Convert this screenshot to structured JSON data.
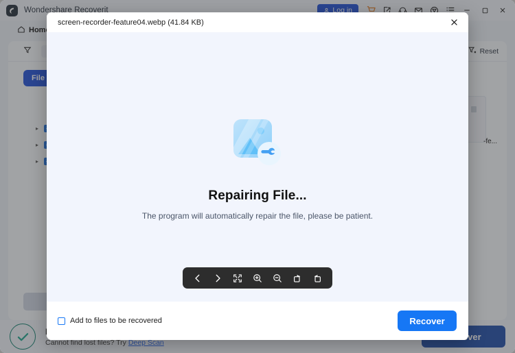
{
  "app": {
    "title": "Wondershare Recoverit",
    "logo_icon": "recoverit-logo-icon",
    "login_label": "Log in",
    "titlebar_icons": [
      {
        "name": "cart-icon"
      },
      {
        "name": "export-icon"
      },
      {
        "name": "headset-icon"
      },
      {
        "name": "mail-icon"
      },
      {
        "name": "history-icon"
      },
      {
        "name": "menu-list-icon"
      }
    ],
    "window_controls": [
      {
        "name": "minimize-button",
        "glyph": "–"
      },
      {
        "name": "maximize-button",
        "glyph": "☐"
      },
      {
        "name": "close-button",
        "glyph": "✕"
      }
    ]
  },
  "nav": {
    "home_label": "Home",
    "home_icon": "home-icon"
  },
  "panel": {
    "filter_icon": "filter-icon",
    "filter_chip_label": "F",
    "reset_label": "Reset",
    "reset_icon": "filter-reset-icon",
    "locate_label": "File Loc",
    "tree_rows": [
      {
        "label": "",
        "checked": true,
        "caret": true
      },
      {
        "label": "",
        "checked": true,
        "caret": true
      },
      {
        "label": "",
        "checked": true,
        "caret": true
      },
      {
        "label": "",
        "checked": false,
        "caret": true
      }
    ],
    "thumb_label": "-fe..."
  },
  "status": {
    "check_icon": "check-circle-icon",
    "title": "F",
    "sub_prefix": "Cannot find lost files? Try ",
    "deep_scan_label": "Deep Scan",
    "recover_label": "Recover"
  },
  "modal": {
    "filename": "screen-recorder-feature04.webp (41.84 KB)",
    "close_icon": "close-icon",
    "repair_icon": "image-repair-icon",
    "title": "Repairing File...",
    "description": "The program will automatically repair the file, please be patient.",
    "toolbar": [
      {
        "name": "previous-button",
        "icon": "chevron-left-icon"
      },
      {
        "name": "next-button",
        "icon": "chevron-right-icon"
      },
      {
        "name": "fullscreen-button",
        "icon": "fullscreen-icon"
      },
      {
        "name": "zoom-in-button",
        "icon": "zoom-in-icon"
      },
      {
        "name": "zoom-out-button",
        "icon": "zoom-out-icon"
      },
      {
        "name": "rotate-right-button",
        "icon": "rotate-right-icon"
      },
      {
        "name": "rotate-left-button",
        "icon": "rotate-left-icon"
      }
    ],
    "add_to_files_label": "Add to files to be recovered",
    "add_to_files_checked": false,
    "recover_label": "Recover"
  },
  "colors": {
    "accent_blue": "#1677f5",
    "dark_blue": "#1d4ed8",
    "panel_bg": "#f5f7fb",
    "modal_body_bg": "#f2f5fd",
    "toolbar_bg": "#2d2d2d",
    "success_green": "#0e7f6e"
  }
}
